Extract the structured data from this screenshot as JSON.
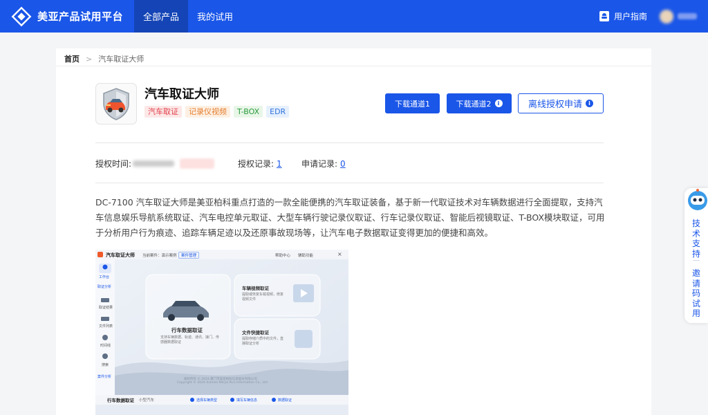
{
  "header": {
    "logo_icon": "diamond-logo-icon",
    "title": "美亚产品试用平台",
    "nav": [
      "全部产品",
      "我的试用"
    ],
    "user_guide": "用户指南",
    "accent": "#1a56e8"
  },
  "breadcrumb": {
    "home": "首页",
    "separator": ">",
    "current": "汽车取证大师"
  },
  "product": {
    "name": "汽车取证大师",
    "tags": [
      {
        "label": "汽车取证",
        "bg": "#fde7e7",
        "fg": "#e0424b"
      },
      {
        "label": "记录仪视频",
        "bg": "#fdf0e3",
        "fg": "#e57d2f"
      },
      {
        "label": "T-BOX",
        "bg": "#e8f6e8",
        "fg": "#2a9a3c"
      },
      {
        "label": "EDR",
        "bg": "#e6f0fd",
        "fg": "#2f73dc"
      }
    ],
    "buttons": {
      "download1": "下载通道1",
      "download2": "下载通道2",
      "offline": "离线授权申请"
    }
  },
  "meta": {
    "auth_time_label": "授权时间:",
    "auth_record_label": "授权记录:",
    "auth_record_value": "1",
    "apply_record_label": "申请记录:",
    "apply_record_value": "0"
  },
  "description": "DC-7100 汽车取证大师是美亚柏科重点打造的一款全能便携的汽车取证装备，基于新一代取证技术对车辆数据进行全面提取，支持汽车信息娱乐导航系统取证、汽车电控单元取证、大型车辆行驶记录仪取证、行车记录仪取证、智能后视镜取证、T-BOX模块取证，可用于分析用户行为痕迹、追踪车辆足迹以及还原事故现场等，让汽车电子数据取证变得更加的便捷和高效。",
  "screenshot": {
    "app_title": "汽车取证大师",
    "current_case": "当前案件：演示案例",
    "case_button": "案件管理",
    "help": "帮助中心",
    "assist": "辅助功能",
    "sidebar": [
      "工作台",
      "取证分析",
      "取证结果",
      "文件列表",
      "时间线",
      "搜索",
      "案件分析"
    ],
    "card_main": "行车数据取证",
    "card_main_sub": "支持车辆数据、轨迹、通讯、接门、传感器数据取证",
    "card_video": "车辆视频取证",
    "card_video_sub": "提取或恢复车载视频，修复视频文件",
    "card_file": "文件快捷取证",
    "card_file_sub": "提取存储介质中的文件，直接取证分析",
    "copyright1": "版权所有 © 2024 厦门市美亚柏科信息股份有限公司",
    "copyright2": "Copyright © 2024 Xiamen Meiya Pico Information Co., Ltd",
    "bottom_title": "行车数据取证",
    "bottom_subtitle": "小型汽车",
    "steps": [
      "选择车辆类型",
      "填写车辆信息",
      "数据取证"
    ]
  },
  "float": {
    "support": "技术支持",
    "invite": "邀请码试用",
    "icon": "robot-icon"
  }
}
